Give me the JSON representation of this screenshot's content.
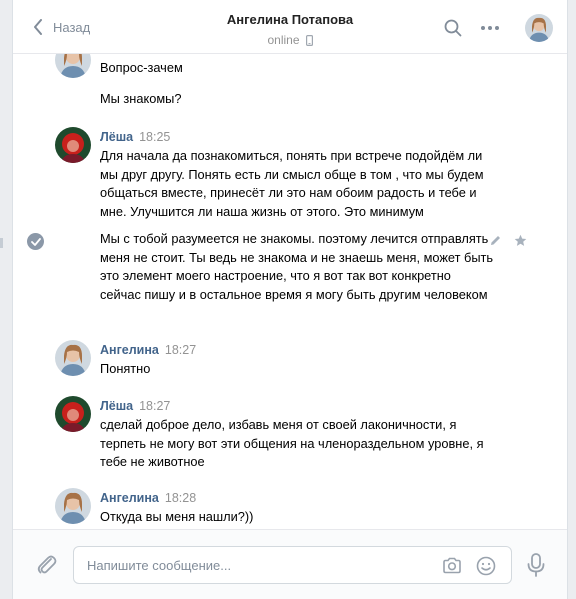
{
  "header": {
    "back_label": "Назад",
    "peer_name": "Ангелина Потапова",
    "peer_status": "online"
  },
  "messages": [
    {
      "author": "",
      "time": "",
      "avatar": "angelina",
      "lines": [
        "Вопрос-зачем",
        "",
        "Мы знакомы?"
      ]
    },
    {
      "author": "Лёша",
      "time": "18:25",
      "avatar": "lesha",
      "text": "Для начала да познакомиться, понять при встрече подойдём ли мы друг другу. Понять есть ли смысл обще в том , что мы будем общаться вместе, принесёт ли это нам обоим радость и тебе и мне. Улучшится ли наша жизнь от этого. Это минимум"
    },
    {
      "author": "",
      "time": "",
      "avatar": "",
      "text": "Мы с тобой разумеется не знакомы. поэтому лечится отправлять меня не стоит. Ты ведь не знакома и не знаешь меня, может быть это элемент моего настроение, что я вот так вот конкретно сейчас пишу и в остальное время я могу быть другим человеком"
    },
    {
      "author": "Ангелина",
      "time": "18:27",
      "avatar": "angelina",
      "text": "Понятно"
    },
    {
      "author": "Лёша",
      "time": "18:27",
      "avatar": "lesha",
      "text": "сделай доброе дело, избавь меня от своей лаконичности, я терпеть не могу вот эти общения на членораздельном уровне, я тебе не животное"
    },
    {
      "author": "Ангелина",
      "time": "18:28",
      "avatar": "angelina",
      "text": "Откуда вы меня нашли?))"
    }
  ],
  "composer": {
    "placeholder": "Напишите сообщение..."
  },
  "icons": [
    "back-chevron-icon",
    "mobile-icon",
    "search-icon",
    "more-icon",
    "check-icon",
    "edit-icon",
    "star-icon",
    "paperclip-icon",
    "camera-icon",
    "smile-icon",
    "microphone-icon"
  ],
  "colors": {
    "accent": "#42648b",
    "muted": "#939393",
    "link": "#818c99"
  }
}
